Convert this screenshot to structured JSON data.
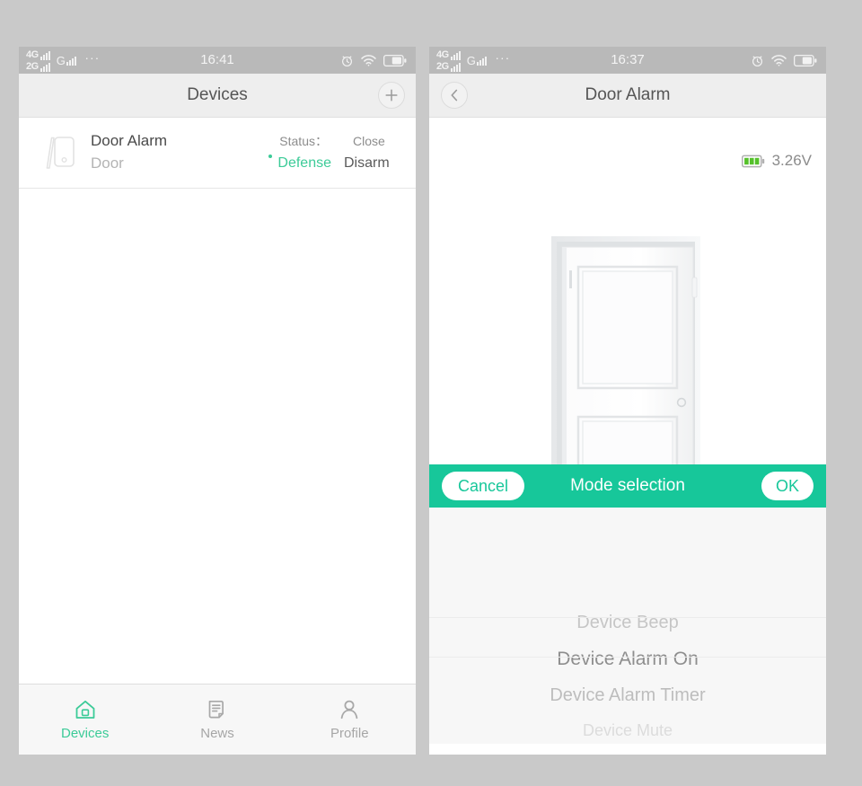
{
  "screens": {
    "left": {
      "statusbar": {
        "sim1_label": "4G",
        "sim2_label": "2G",
        "sim3_label": "G",
        "overflow_dots": "···",
        "time": "16:41",
        "alarm_icon": "alarm-clock-icon",
        "wifi_icon": "wifi-icon",
        "battery_icon": "battery-icon"
      },
      "navbar": {
        "title": "Devices",
        "add_icon": "plus-icon"
      },
      "device": {
        "icon": "door-sensor-icon",
        "name": "Door Alarm",
        "subtitle": "Door",
        "status_label": "Status：",
        "status_value": "Close",
        "mode_active": "Defense",
        "mode_inactive": "Disarm"
      },
      "tabs": [
        {
          "label": "Devices",
          "icon": "home-icon",
          "active": true
        },
        {
          "label": "News",
          "icon": "news-icon",
          "active": false
        },
        {
          "label": "Profile",
          "icon": "person-icon",
          "active": false
        }
      ]
    },
    "right": {
      "statusbar": {
        "sim1_label": "4G",
        "sim2_label": "2G",
        "sim3_label": "G",
        "overflow_dots": "···",
        "time": "16:37",
        "alarm_icon": "alarm-clock-icon",
        "wifi_icon": "wifi-icon",
        "battery_icon": "battery-icon"
      },
      "navbar": {
        "title": "Door Alarm",
        "back_icon": "chevron-left-icon"
      },
      "battery": {
        "icon": "battery-level-icon",
        "voltage": "3.26V",
        "bars": 3
      },
      "artwork": {
        "name": "white-door-illustration"
      },
      "picker": {
        "cancel_label": "Cancel",
        "title": "Mode selection",
        "ok_label": "OK",
        "options": [
          {
            "label": "Device Beep",
            "selected": false
          },
          {
            "label": "Device Alarm On",
            "selected": true
          },
          {
            "label": "Device Alarm Timer",
            "selected": false
          },
          {
            "label": "Device Mute",
            "selected": false
          }
        ]
      }
    }
  },
  "colors": {
    "accent_green": "#3ccb98",
    "picker_green": "#17c79a",
    "page_background": "#c9c9c9",
    "navbar_background": "#eeeeee",
    "statusbar_background": "#b9b9b9",
    "battery_green": "#55c12a"
  }
}
